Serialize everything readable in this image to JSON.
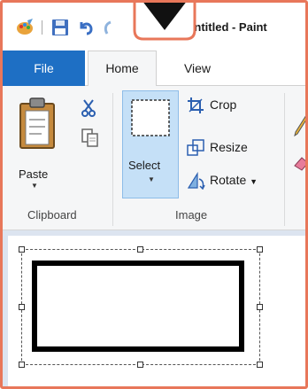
{
  "window": {
    "title": "Untitled - Paint"
  },
  "tabs": {
    "file": "File",
    "home": "Home",
    "view": "View"
  },
  "clipboard": {
    "paste_label": "Paste",
    "group_label": "Clipboard"
  },
  "image": {
    "select_label": "Select",
    "crop_label": "Crop",
    "resize_label": "Resize",
    "rotate_label": "Rotate",
    "group_label": "Image"
  },
  "icons": {
    "app": "paint-app-icon",
    "save": "save-icon",
    "undo": "undo-icon",
    "cut": "scissors-icon",
    "copy": "copy-icon",
    "paste": "clipboard-icon",
    "select": "dashed-rectangle-icon",
    "crop": "crop-icon",
    "resize": "resize-icon",
    "rotate": "rotate-icon",
    "pencil": "pencil-icon",
    "eraser": "eraser-icon",
    "overlay": "down-arrow-icon"
  },
  "colors": {
    "frame": "#e8775a",
    "file_tab": "#1e6fc4",
    "select_highlight": "#c5e0f7",
    "ribbon": "#f5f6f7",
    "canvas_bg": "#dce4f0"
  }
}
